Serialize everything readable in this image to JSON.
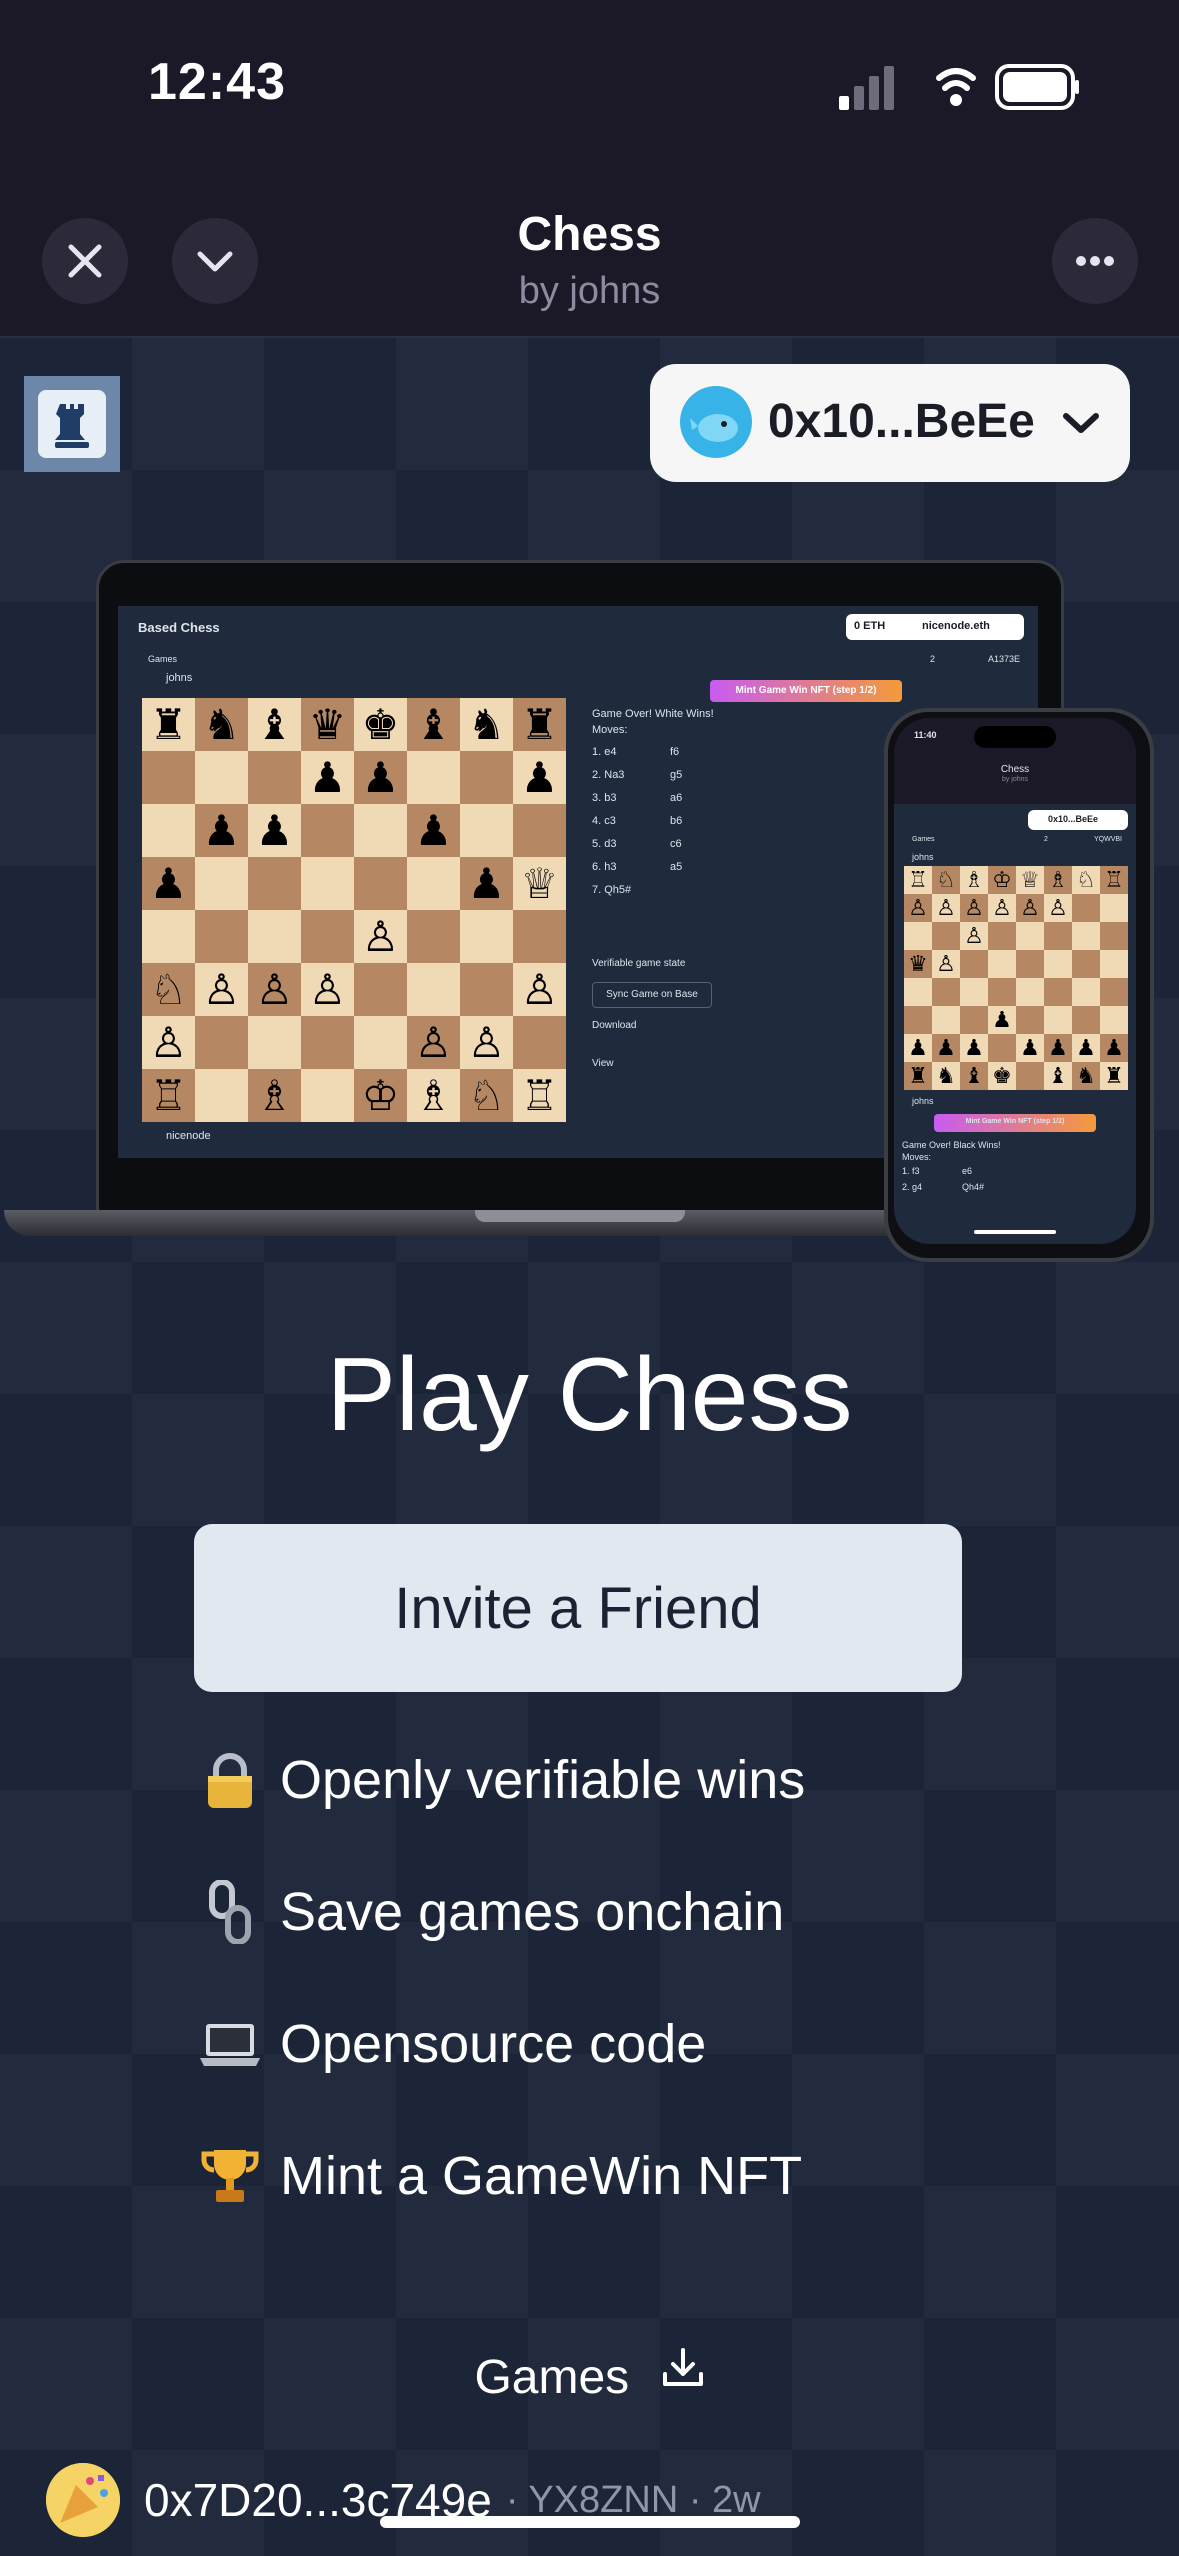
{
  "status_bar": {
    "time": "12:43"
  },
  "header": {
    "title": "Chess",
    "subtitle": "by johns"
  },
  "wallet": {
    "address": "0x10...BeEe"
  },
  "screenshot_laptop": {
    "app_title": "Based Chess",
    "eth_balance": "0 ETH",
    "ens_name": "nicenode.eth",
    "back_label": "Games",
    "views": "2",
    "game_id": "A1373E",
    "top_player": "johns",
    "bottom_player": "nicenode",
    "mint_label": "Mint Game Win NFT (step 1/2)",
    "result": "Game Over! White Wins!",
    "moves_label": "Moves:",
    "moves": [
      {
        "n": "1.",
        "w": "e4",
        "b": "f6"
      },
      {
        "n": "2.",
        "w": "Na3",
        "b": "g5"
      },
      {
        "n": "3.",
        "w": "b3",
        "b": "a6"
      },
      {
        "n": "4.",
        "w": "c3",
        "b": "b6"
      },
      {
        "n": "5.",
        "w": "d3",
        "b": "c6"
      },
      {
        "n": "6.",
        "w": "h3",
        "b": "a5"
      },
      {
        "n": "7.",
        "w": "Qh5#",
        "b": ""
      }
    ],
    "verify_label": "Verifiable game state",
    "sync_label": "Sync Game on Base",
    "download_label": "Download",
    "view_label": "View"
  },
  "screenshot_phone": {
    "time": "11:40",
    "title": "Chess",
    "subtitle": "by johns",
    "wallet": "0x10...BeEe",
    "back_label": "Games",
    "views": "2",
    "game_id": "YQWVBI",
    "top_player": "johns",
    "bottom_player": "johns",
    "mint_label": "Mint Game Win NFT (step 1/2)",
    "result": "Game Over! Black Wins!",
    "moves_label": "Moves:",
    "move1": "1. f3",
    "move1b": "e6",
    "move2": "2. g4",
    "move2b": "Qh4#"
  },
  "main": {
    "title": "Play Chess",
    "invite_button": "Invite a Friend",
    "features": [
      {
        "icon": "lock-icon",
        "emoji": "🔒",
        "label": "Openly verifiable wins"
      },
      {
        "icon": "chain-icon",
        "emoji": "⛓️",
        "label": "Save games onchain"
      },
      {
        "icon": "laptop-icon",
        "emoji": "💻",
        "label": "Opensource code"
      },
      {
        "icon": "trophy-icon",
        "emoji": "🏆",
        "label": "Mint a GameWin NFT"
      }
    ],
    "games_link": "Games"
  },
  "footer": {
    "address": "0x7D20...3c749e",
    "meta": "· YX8ZNN · 2w"
  }
}
